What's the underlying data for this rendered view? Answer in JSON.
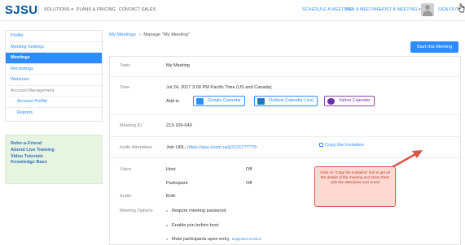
{
  "header": {
    "logo": "SJSU",
    "nav_left": [
      "SOLUTIONS ▾",
      "PLANS & PRICING",
      "CONTACT SALES"
    ],
    "nav_right": [
      "SCHEDULE A MEETING",
      "JOIN A MEETING",
      "HOST A MEETING ▾"
    ],
    "sign_out": "SIGN OUT"
  },
  "sidebar": {
    "items": [
      {
        "label": "Profile"
      },
      {
        "label": "Meeting Settings"
      },
      {
        "label": "Meetings"
      },
      {
        "label": "Recordings"
      },
      {
        "label": "Webinars"
      },
      {
        "label": "Account Management"
      },
      {
        "label": "Account Profile"
      },
      {
        "label": "Reports"
      }
    ],
    "promo": [
      "Refer-a-Friend",
      "Attend Live Training",
      "Video Tutorials",
      "Knowledge Base"
    ]
  },
  "breadcrumb": {
    "root": "My Meetings",
    "sep": ">",
    "current": "Manage \"My Meeting\""
  },
  "start_button": "Start this Meeting",
  "details": {
    "topic_label": "Topic",
    "topic": "My Meeting",
    "time_label": "Time",
    "time": "Jul 24, 2017 3:00 PM Pacific Time (US and Canada)",
    "add_to": "Add to",
    "calendars": [
      "Google Calendar",
      "Outlook Calendar (.ics)",
      "Yahoo Calendar"
    ],
    "meeting_id_label": "Meeting ID",
    "meeting_id": "213-109-649",
    "invite_label": "Invite Attendees",
    "join_url_label": "Join URL:",
    "join_url": "https://sjsu.zoom.us/j/2131?????9",
    "copy_invitation": "Copy the Invitation",
    "video_label": "Video",
    "host_label": "Host",
    "host_value": "Off",
    "participant_label": "Participant",
    "participant_value": "Off",
    "audio_label": "Audio",
    "audio_value": "Both",
    "options_label": "Meeting Options",
    "options": [
      "Require meeting password",
      "Enable join before host",
      "Mute participants upon entry"
    ],
    "supported_versions": "Supported versions"
  },
  "callout": "Click on \"Copy the Invitation\" link to get all the details of the meeting and share them with the attendees over email",
  "colors": {
    "accent": "#2d8cff",
    "logo": "#0055a2",
    "callout_border": "#d9574a",
    "callout_fill": "#ffd9d2"
  }
}
